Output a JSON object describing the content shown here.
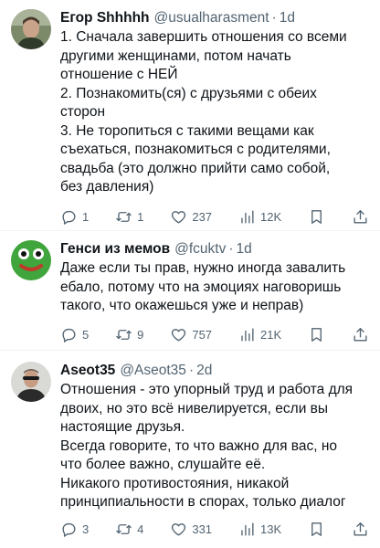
{
  "tweets": [
    {
      "name": "Егор Shhhhh",
      "handle": "@usualharasment",
      "dot": "·",
      "time": "1d",
      "lines": [
        "1. Сначала завершить отношения со всеми",
        "другими женщинами, потом начать",
        "отношение с НЕЙ",
        "2. Познакомить(ся) с друзьями с обеих",
        "сторон",
        "3. Не торопиться с такими вещами как",
        "съехаться, познакомиться с родителями,",
        "свадьба (это должно прийти само собой,",
        "без давления)"
      ],
      "replies": "1",
      "reposts": "1",
      "likes": "237",
      "views": "12K"
    },
    {
      "name": "Генси из мемов",
      "handle": "@fcuktv",
      "dot": "·",
      "time": "1d",
      "lines": [
        "Даже если ты прав, нужно иногда завалить",
        "ебало, потому что на эмоциях наговоришь",
        "такого, что окажешься уже и неправ)"
      ],
      "replies": "5",
      "reposts": "9",
      "likes": "757",
      "views": "21K"
    },
    {
      "name": "Aseot35",
      "handle": "@Aseot35",
      "dot": "·",
      "time": "2d",
      "lines": [
        "Отношения - это упорный труд и работа для",
        "двоих, но это всё нивелируется, если вы",
        "настоящие друзья.",
        "Всегда говорите, то что важно для вас, но",
        "что более важно, слушайте её.",
        "Никакого противостояния, никакой",
        "принципиальности в спорах, только диалог"
      ],
      "replies": "3",
      "reposts": "4",
      "likes": "331",
      "views": "13K"
    }
  ],
  "icons": {
    "reply": "reply-icon",
    "repost": "repost-icon",
    "like": "heart-icon",
    "views": "views-icon",
    "bookmark": "bookmark-icon",
    "share": "share-icon"
  },
  "colors": {
    "text": "#0f1419",
    "secondary": "#536471",
    "divider": "#eff3f4",
    "frog": "#3fa53c"
  }
}
